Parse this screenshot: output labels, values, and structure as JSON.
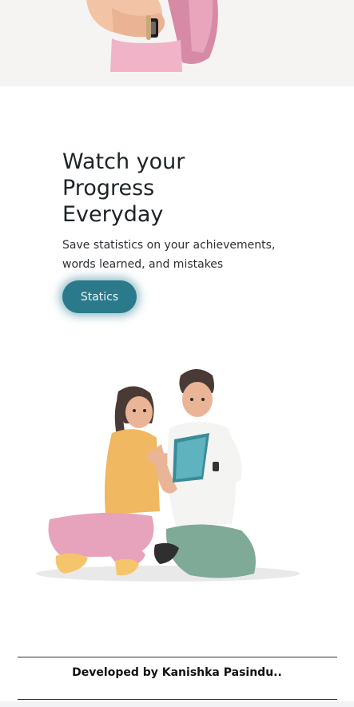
{
  "hero": {
    "title": "Watch your Progress Everyday",
    "subtitle": "Save statistics on your achievements, words learned, and mistakes",
    "cta_label": "Statics"
  },
  "footer": {
    "credit": "Developed by Kanishka Pasindu.."
  },
  "colors": {
    "accent": "#2a7a8c",
    "top_strip": "#f5f4f2"
  },
  "icons": {
    "top_image": "person-with-backpack-illustration",
    "main_image": "students-studying-illustration"
  }
}
